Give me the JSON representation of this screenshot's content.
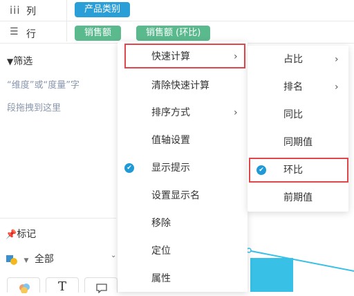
{
  "shelves": {
    "columns": {
      "label": "列",
      "icon": "columns-icon",
      "pills": [
        "产品类别"
      ]
    },
    "rows": {
      "label": "行",
      "icon": "rows-icon",
      "pills": [
        "销售额",
        "销售额 (环比)"
      ]
    }
  },
  "colors": {
    "dimension_pill": "#2a9ed6",
    "measure_pill": "#5bb98e",
    "highlight": "#e0474c",
    "check": "#1f9ad6",
    "chart_bar": "#39c0e6"
  },
  "filter": {
    "title": "筛选",
    "hint_line1": "“维度”或“度量”字",
    "hint_line2": "段拖拽到这里"
  },
  "marks": {
    "title": "标记",
    "type_value": "全部"
  },
  "context_menu": {
    "items": [
      "快速计算",
      "清除快速计算",
      "排序方式",
      "值轴设置",
      "显示提示",
      "设置显示名",
      "移除",
      "定位",
      "属性"
    ]
  },
  "submenu": {
    "items": [
      "占比",
      "排名",
      "同比",
      "同期值",
      "环比",
      "前期值"
    ]
  },
  "icons": {
    "arrow": "›",
    "check": "✔",
    "text_tool": "T"
  }
}
